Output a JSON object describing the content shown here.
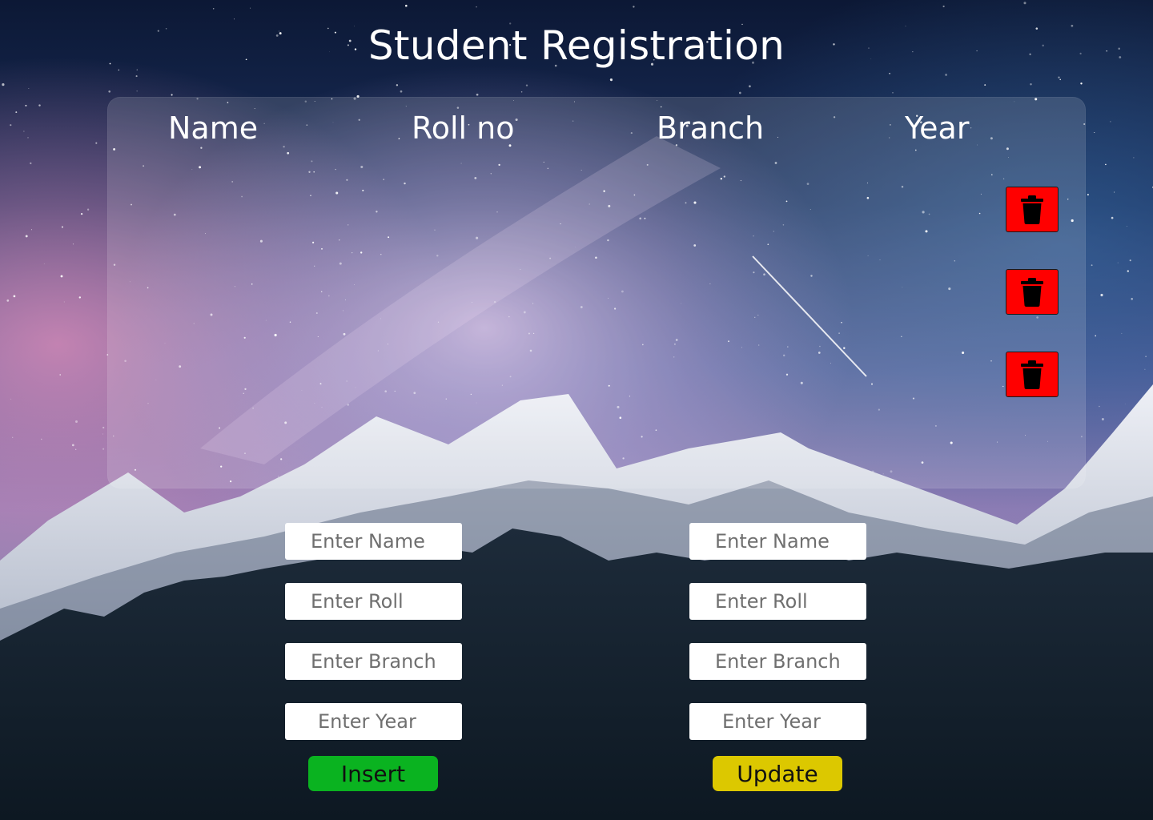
{
  "page": {
    "title": "Student Registration"
  },
  "table": {
    "columns": [
      "Name",
      "Roll no",
      "Branch",
      "Year"
    ],
    "rows": [
      {
        "name": "",
        "roll": "",
        "branch": "",
        "year": "",
        "delete_icon": "trash-icon"
      },
      {
        "name": "",
        "roll": "",
        "branch": "",
        "year": "",
        "delete_icon": "trash-icon"
      },
      {
        "name": "",
        "roll": "",
        "branch": "",
        "year": "",
        "delete_icon": "trash-icon"
      }
    ]
  },
  "insert_form": {
    "name_placeholder": "Enter Name",
    "roll_placeholder": "Enter Roll",
    "branch_placeholder": "Enter Branch",
    "year_placeholder": "Enter Year",
    "button_label": "Insert"
  },
  "update_form": {
    "name_placeholder": "Enter Name",
    "roll_placeholder": "Enter Roll",
    "branch_placeholder": "Enter Branch",
    "year_placeholder": "Enter Year",
    "button_label": "Update"
  },
  "colors": {
    "delete_button": "#ff0000",
    "insert_button": "#0ab320",
    "update_button": "#dcc800",
    "text": "#ffffff"
  }
}
